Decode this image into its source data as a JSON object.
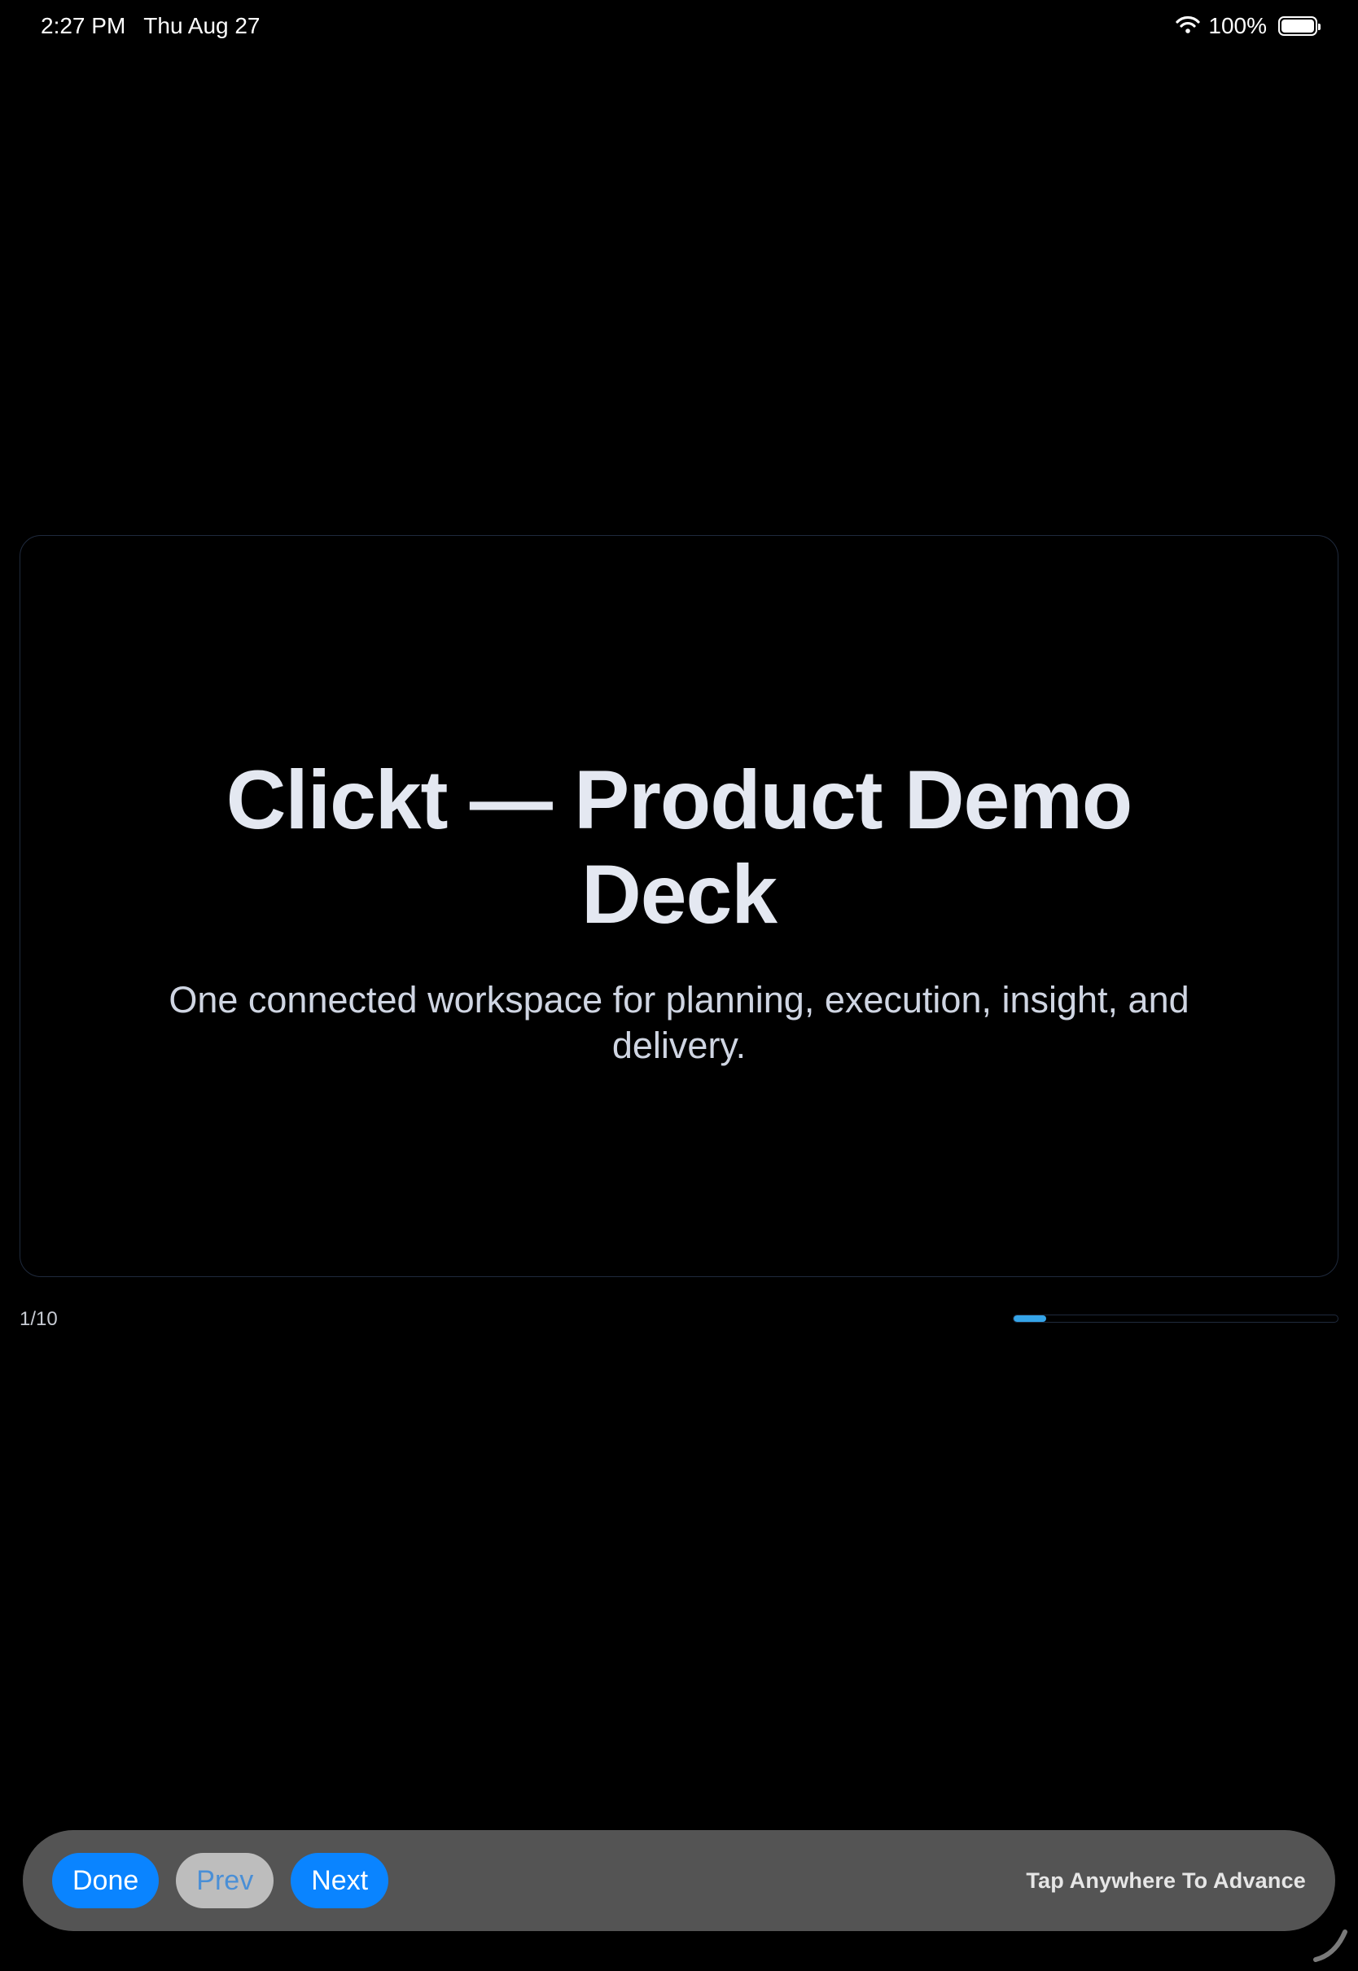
{
  "status_bar": {
    "time": "2:27 PM",
    "date": "Thu Aug 27",
    "battery": "100%",
    "wifi_icon": "wifi-icon",
    "battery_icon": "battery-icon"
  },
  "slide": {
    "title": "Clickt — Product Demo Deck",
    "subtitle": "One connected workspace for planning, execution, insight, and delivery."
  },
  "progress": {
    "counter": "1/10",
    "fraction": 0.1,
    "accent": "#35a4e8"
  },
  "toolbar": {
    "done_label": "Done",
    "prev_label": "Prev",
    "next_label": "Next",
    "hint": "Tap Anywhere To Advance",
    "button_color": "#0a84ff",
    "disabled_color": "#bdbdbd"
  }
}
